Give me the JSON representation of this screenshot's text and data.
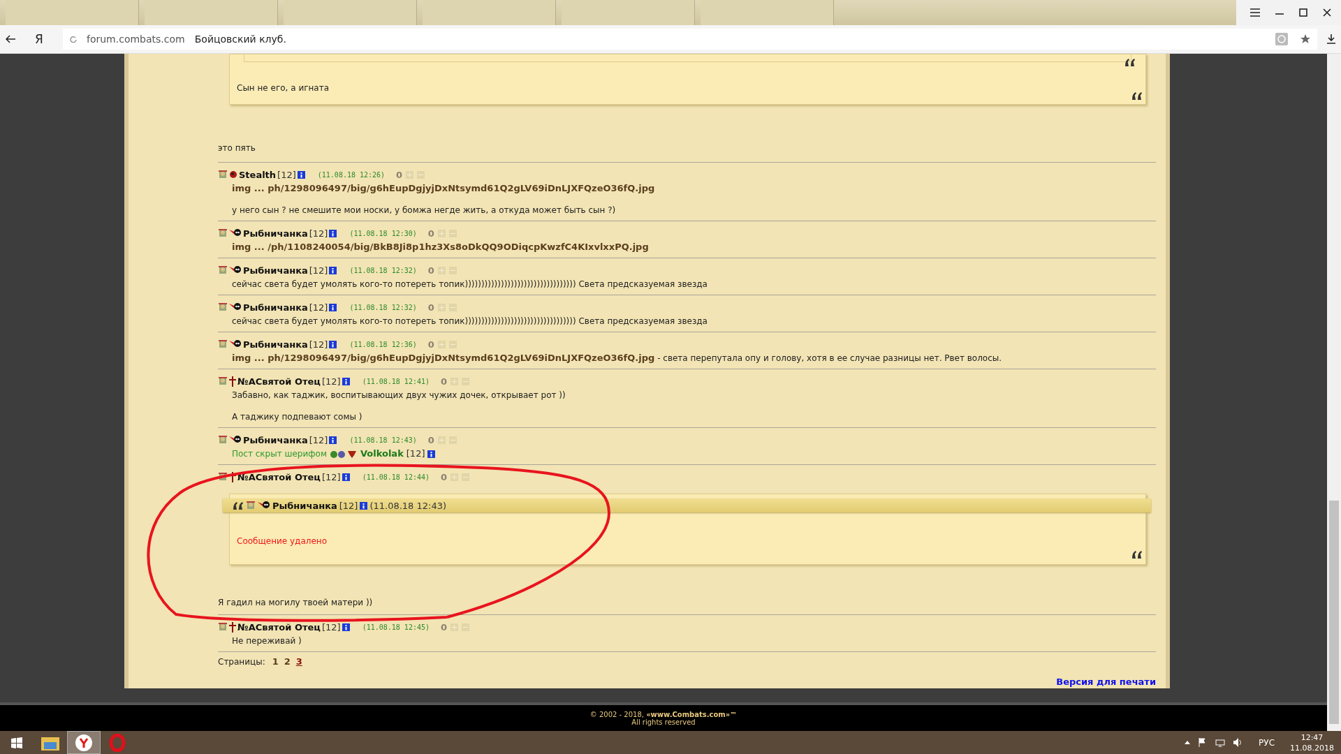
{
  "browser": {
    "logo": "Я",
    "url": "forum.combats.com",
    "page_title": "Бойцовский клуб."
  },
  "top_quote": {
    "text": "Сын не его, а игната"
  },
  "intro_text": "это пять",
  "posts": [
    {
      "kind": "dark",
      "author": "Stealth",
      "rank": "[12]",
      "time": "(11.08.18 12:26)",
      "score": "0",
      "body": [
        {
          "kind": "link",
          "link": "img ... ph/1298096497/big/g6hEupDgjyjDxNtsymd61Q2gLV69iDnLJXFQzeO36fQ.jpg"
        },
        {
          "kind": "gap"
        },
        {
          "kind": "text",
          "text": "у него сын ? не смешите мои носки, у бомжа негде жить, а откуда может быть сын ?)"
        }
      ]
    },
    {
      "kind": "flash",
      "author": "Рыбничанка",
      "rank": "[12]",
      "time": "(11.08.18 12:30)",
      "score": "0",
      "body": [
        {
          "kind": "link",
          "link": "img ... /ph/1108240054/big/BkB8Ji8p1hz3Xs8oDkQQ9ODiqcpKwzfC4KIxvlxxPQ.jpg"
        }
      ]
    },
    {
      "kind": "flash",
      "author": "Рыбничанка",
      "rank": "[12]",
      "time": "(11.08.18 12:32)",
      "score": "0",
      "body": [
        {
          "kind": "text",
          "text": "сейчас света будет умолять кого-то потереть топик)))))))))))))))))))))))))))))))))) Света предсказуемая звезда"
        }
      ]
    },
    {
      "kind": "flash",
      "author": "Рыбничанка",
      "rank": "[12]",
      "time": "(11.08.18 12:32)",
      "score": "0",
      "body": [
        {
          "kind": "text",
          "text": "сейчас света будет умолять кого-то потереть топик)))))))))))))))))))))))))))))))))) Света предсказуемая звезда"
        }
      ]
    },
    {
      "kind": "flash",
      "author": "Рыбничанка",
      "rank": "[12]",
      "time": "(11.08.18 12:36)",
      "score": "0",
      "body": [
        {
          "kind": "link",
          "link": "img ... ph/1298096497/big/g6hEupDgjyjDxNtsymd61Q2gLV69iDnLJXFQzeO36fQ.jpg",
          "text": "- света перепутала опу и голову, хотя в ее случае разницы нет. Рвет волосы."
        }
      ]
    },
    {
      "kind": "cross",
      "author": "№АСвятой Отец",
      "rank": "[12]",
      "time": "(11.08.18 12:41)",
      "score": "0",
      "body": [
        {
          "kind": "text",
          "text": "Забавно, как таджик, воспитывающих двух чужих дочек, открывает рот ))"
        },
        {
          "kind": "gap"
        },
        {
          "kind": "text",
          "text": "А таджику подпевают сомы )"
        }
      ]
    },
    {
      "kind": "flash",
      "author": "Рыбничанка",
      "rank": "[12]",
      "time": "(11.08.18 12:43)",
      "score": "0",
      "body": [
        {
          "kind": "hidden",
          "text": "Пост скрыт шерифом",
          "sheriff": "Volkolak",
          "rank": "[12]"
        }
      ]
    },
    {
      "kind": "cross",
      "author": "№АСвятой Отец",
      "rank": "[12]",
      "time": "(11.08.18 12:44)",
      "score": "0",
      "body": [
        {
          "kind": "quote",
          "author": "Рыбничанка",
          "rank": "[12]",
          "time": "(11.08.18 12:43)",
          "text": "Сообщение удалено"
        },
        {
          "kind": "plain",
          "text": "Я гадил на могилу твоей матери ))"
        }
      ]
    },
    {
      "kind": "cross",
      "author": "№АСвятой Отец",
      "rank": "[12]",
      "time": "(11.08.18 12:45)",
      "score": "0",
      "body": [
        {
          "kind": "text",
          "text": "Не переживай )"
        }
      ]
    }
  ],
  "pages": {
    "label": "Страницы:",
    "items": [
      {
        "label": "1",
        "selected": false
      },
      {
        "label": "2",
        "selected": false
      },
      {
        "label": "3",
        "selected": true
      }
    ]
  },
  "print_link": "Версия для печати",
  "footer": {
    "copyright": "© 2002 - 2018, **«www.Combats.com»™**",
    "rights": "All rights reserved"
  },
  "taskbar": {
    "language": "РУС",
    "time": "12:47",
    "date": "11.08.2018"
  }
}
